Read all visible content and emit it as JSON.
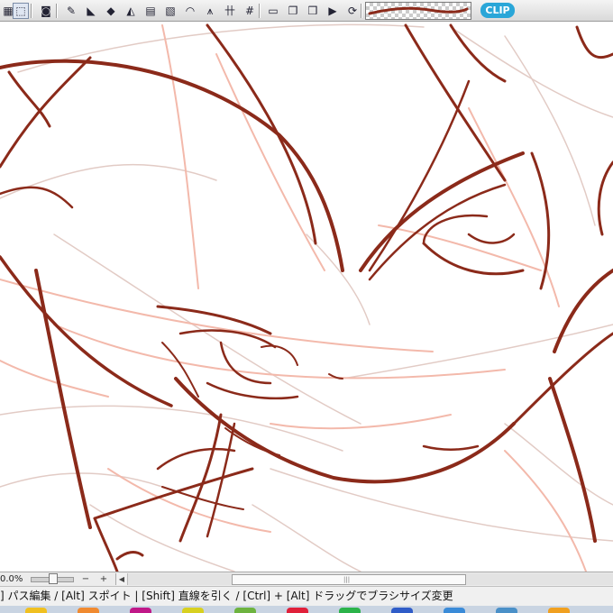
{
  "toolbar": {
    "buttons": [
      {
        "name": "layer-mask-icon",
        "glyph": "▦"
      },
      {
        "name": "selection-area-icon",
        "glyph": "⬚"
      },
      {
        "name": "camera-icon",
        "glyph": "◙"
      },
      {
        "name": "pen-ruler-icon",
        "glyph": "✎"
      },
      {
        "name": "triangle-ruler-icon",
        "glyph": "◣"
      },
      {
        "name": "3d-cube-icon",
        "glyph": "◆"
      },
      {
        "name": "fill-bucket-icon",
        "glyph": "◭"
      },
      {
        "name": "frame-border-icon",
        "glyph": "▤"
      },
      {
        "name": "speed-line-icon",
        "glyph": "▧"
      },
      {
        "name": "curve-ruler-icon",
        "glyph": "◠"
      },
      {
        "name": "perspective-ruler-icon",
        "glyph": "⩚"
      },
      {
        "name": "symmetric-ruler-icon",
        "glyph": "卄"
      },
      {
        "name": "grid-icon",
        "glyph": "#"
      },
      {
        "name": "page-icon",
        "glyph": "▭"
      },
      {
        "name": "layer-transfer-icon",
        "glyph": "❐"
      },
      {
        "name": "folder-icon",
        "glyph": "❒"
      },
      {
        "name": "play-icon",
        "glyph": "▶"
      },
      {
        "name": "refresh-icon",
        "glyph": "⟳"
      }
    ],
    "logo_text": "CLIP",
    "brush_color": "#8b2a1a"
  },
  "navigator": {
    "zoom": "0.0%",
    "zoom_out_icon": "−",
    "zoom_in_icon": "+",
    "scroll_left_icon": "◀",
    "scroll_grip_icon": "|||"
  },
  "statusbar": {
    "text": "] パス編集 / [Alt] スポイト | [Shift] 直線を引く / [Ctrl] + [Alt] ドラッグでブラシサイズ変更"
  },
  "canvas": {
    "line_color": "#8b2a1a",
    "sketch_color": "#f3b9ab",
    "faint_color": "#e2cbc5"
  },
  "taskbar": {
    "items": [
      "#f0c020",
      "#f08a30",
      "#c01888",
      "#d8d020",
      "#6db33f",
      "#e0203a",
      "#2bb34a",
      "#2f5cc8",
      "#3a8bd8",
      "#4a90c8",
      "#f0a020"
    ]
  }
}
